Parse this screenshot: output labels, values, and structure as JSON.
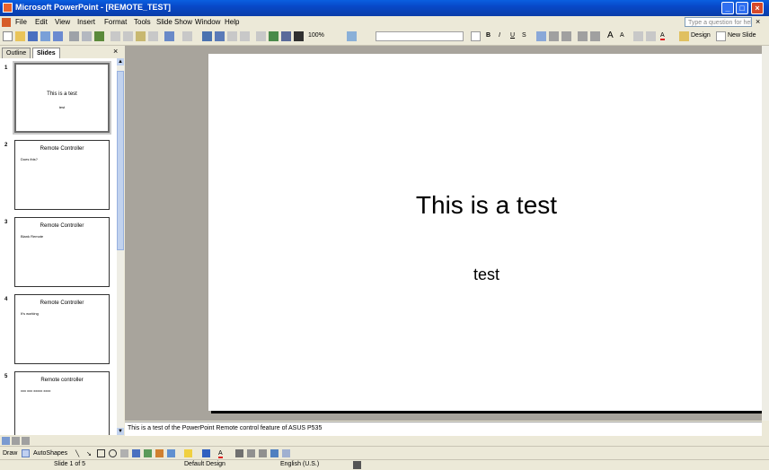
{
  "window": {
    "title": "Microsoft PowerPoint - [REMOTE_TEST]"
  },
  "menu": {
    "items": [
      "File",
      "Edit",
      "View",
      "Insert",
      "Format",
      "Tools",
      "Slide Show",
      "Window",
      "Help"
    ],
    "help_placeholder": "Type a question for help"
  },
  "toolbar": {
    "zoom": "100%",
    "design_label": "Design",
    "new_slide_label": "New Slide"
  },
  "pane": {
    "tabs": [
      "Outline",
      "Slides"
    ]
  },
  "slides": [
    {
      "num": "1",
      "title": "This is a test",
      "body": "test"
    },
    {
      "num": "2",
      "title": "Remote Controller",
      "body": "Does this?"
    },
    {
      "num": "3",
      "title": "Remote Controller",
      "body": "Blank Remote"
    },
    {
      "num": "4",
      "title": "Remote Controller",
      "body": "It's working"
    },
    {
      "num": "5",
      "title": "Remote controller",
      "body": "xxx xxx xxxxx xxxx"
    }
  ],
  "current_slide": {
    "title": "This is a test",
    "subtitle": "test"
  },
  "notes": "This is a test of the PowerPoint Remote control feature of ASUS P535",
  "drawing": {
    "draw_label": "Draw",
    "autoshapes_label": "AutoShapes"
  },
  "status": {
    "slide": "Slide 1 of 5",
    "design": "Default Design",
    "language": "English (U.S.)"
  }
}
